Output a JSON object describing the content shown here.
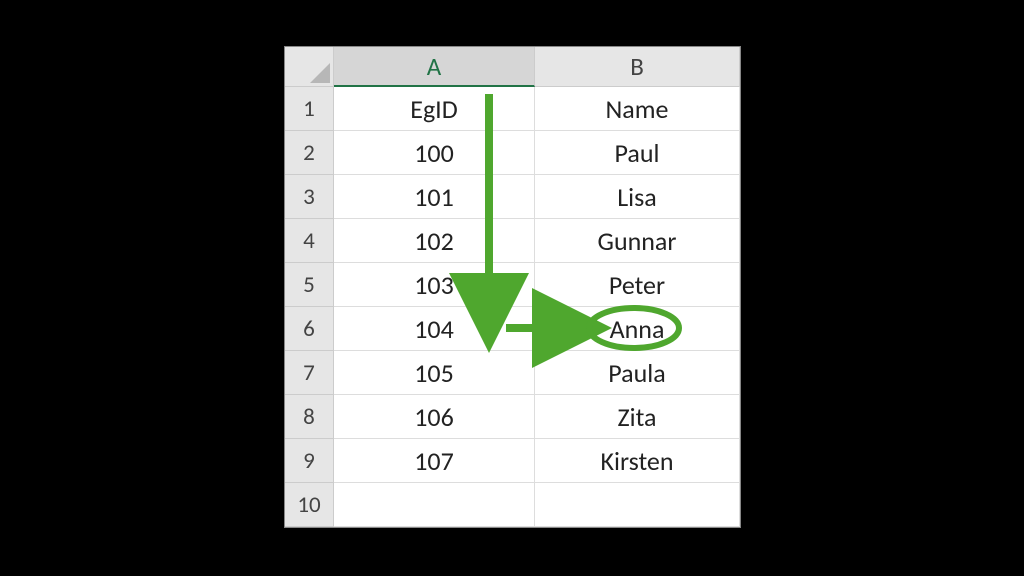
{
  "columns": {
    "a": "A",
    "b": "B"
  },
  "rows": {
    "r1": "1",
    "r2": "2",
    "r3": "3",
    "r4": "4",
    "r5": "5",
    "r6": "6",
    "r7": "7",
    "r8": "8",
    "r9": "9",
    "r10": "10"
  },
  "cells": {
    "a1": "EgID",
    "b1": "Name",
    "a2": "100",
    "b2": "Paul",
    "a3": "101",
    "b3": "Lisa",
    "a4": "102",
    "b4": "Gunnar",
    "a5": "103",
    "b5": "Peter",
    "a6": "104",
    "b6": "Anna",
    "a7": "105",
    "b7": "Paula",
    "a8": "106",
    "b8": "Zita",
    "a9": "107",
    "b9": "Kirsten",
    "a10": "",
    "b10": ""
  },
  "annotation": {
    "highlight_cell": "b6",
    "arrow_color": "#4fa72e"
  }
}
